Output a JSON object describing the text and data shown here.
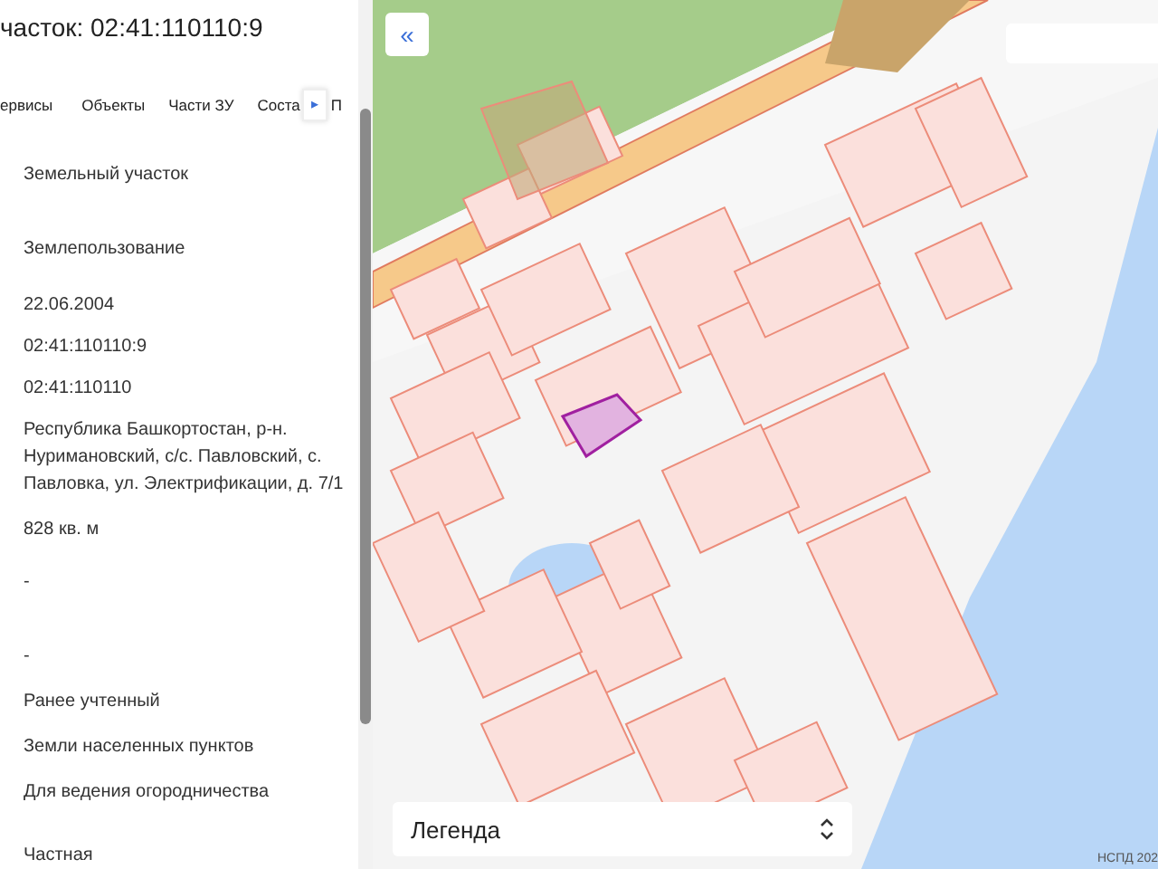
{
  "panel": {
    "title": "часток: 02:41:110110:9",
    "tabs": [
      {
        "label": "ервисы"
      },
      {
        "label": "Объекты"
      },
      {
        "label": "Части ЗУ"
      },
      {
        "label": "Соста"
      }
    ],
    "tab_scroll": "▸",
    "tab_cut": "П",
    "values": [
      "Земельный участок",
      "Землепользование",
      "22.06.2004",
      "02:41:110110:9",
      "02:41:110110",
      "Республика Башкортостан, р-н. Нуримановский, с/с. Павловский, с. Павловка, ул. Электрификации, д. 7/1",
      "828 кв. м",
      "-",
      "-",
      "Ранее учтенный",
      "Земли населенных пунктов",
      "Для ведения огородничества",
      "Частная"
    ]
  },
  "map": {
    "collapse": "«",
    "legend": {
      "label": "Легенда"
    },
    "attribution": "НСПД 202"
  }
}
